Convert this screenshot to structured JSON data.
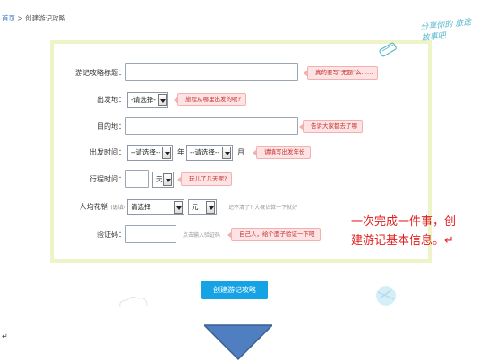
{
  "breadcrumb": {
    "home": "首页",
    "separator": ">",
    "current": "创建游记攻略"
  },
  "decoration": {
    "handwritten": "分享你的 旅途故事吧"
  },
  "form": {
    "title_label": "游记攻略标题：",
    "title_tip": "真的要写\"无题\"么……",
    "departure_label": "出发地：",
    "departure_select": "-请选择-",
    "departure_tip": "旅程从哪里出发的呢?",
    "destination_label": "目的地：",
    "destination_tip": "告诉大家都去了哪",
    "time_label": "出发时间：",
    "year_select": "--请选择--",
    "year_unit": "年",
    "month_select": "--请选择--",
    "month_unit": "月",
    "time_tip": "请填写出发年份",
    "duration_label": "行程时间：",
    "duration_unit_select": "天",
    "duration_tip": "玩儿了几天呢?",
    "cost_label": "人均花销",
    "cost_optional": "(选填)",
    "cost_select": "请选择",
    "currency_select": "元",
    "cost_hint": "记不清了? 大概估算一下就好",
    "captcha_label": "验证码：",
    "captcha_hint": "点击输入验证码",
    "captcha_tip": "自己人，给个面子验证一下吧",
    "submit_label": "创建游记攻略"
  },
  "annotation": {
    "line1": "一次完成一件事，创",
    "line2": "建游记基本信息。↵"
  },
  "return_mark": "↵",
  "colors": {
    "accent": "#16a3e6",
    "tip_bg": "#fde3e3",
    "tip_text": "#c43030",
    "panel_border": "#eef3c8",
    "note": "#e01f1f",
    "arrow": "#4f7fc0"
  }
}
